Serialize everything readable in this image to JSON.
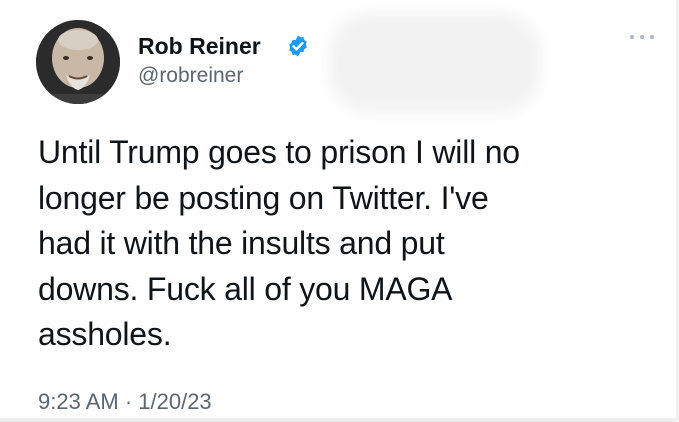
{
  "author": {
    "display_name": "Rob Reiner",
    "handle": "@robreiner",
    "verified": true,
    "avatar_icon": "person-photo-icon"
  },
  "tweet": {
    "text_lines": [
      "Until Trump goes to prison I will no",
      "longer be posting on Twitter. I've",
      "had it with the insults and put",
      "downs. Fuck all of you MAGA",
      "assholes."
    ],
    "timestamp": "9:23 AM · 1/20/23"
  },
  "icons": {
    "verified": "verified-badge-icon",
    "more": "more-options-icon"
  },
  "colors": {
    "verified_blue": "#1d9bf0",
    "text_primary": "#0f1419",
    "text_secondary": "#5b6671"
  }
}
